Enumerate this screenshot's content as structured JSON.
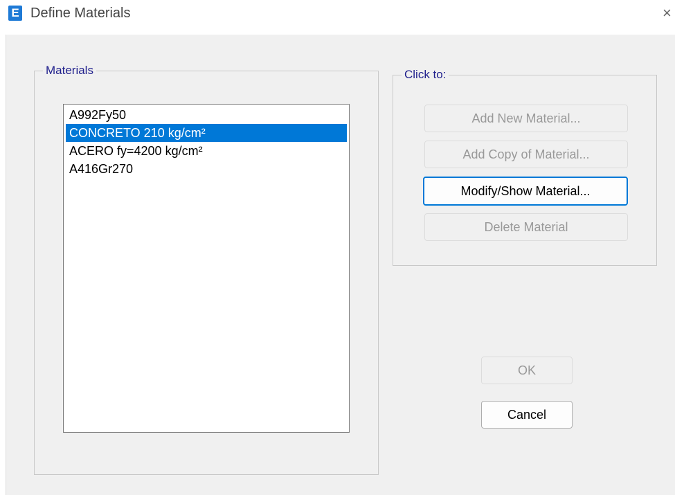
{
  "window": {
    "title": "Define Materials",
    "app_icon_letter": "E",
    "close_glyph": "×"
  },
  "materials_group": {
    "label": "Materials",
    "items": [
      {
        "label": "A992Fy50",
        "selected": false
      },
      {
        "label": "CONCRETO 210 kg/cm²",
        "selected": true
      },
      {
        "label": "ACERO fy=4200 kg/cm²",
        "selected": false
      },
      {
        "label": "A416Gr270",
        "selected": false
      }
    ]
  },
  "click_to_group": {
    "label": "Click to:",
    "add_new_label": "Add New Material...",
    "add_copy_label": "Add Copy of Material...",
    "modify_show_label": "Modify/Show Material...",
    "delete_label": "Delete Material"
  },
  "footer": {
    "ok_label": "OK",
    "cancel_label": "Cancel"
  },
  "colors": {
    "selection": "#0078d7",
    "group_label": "#1f1f8c",
    "app_icon": "#1e7ad6"
  }
}
